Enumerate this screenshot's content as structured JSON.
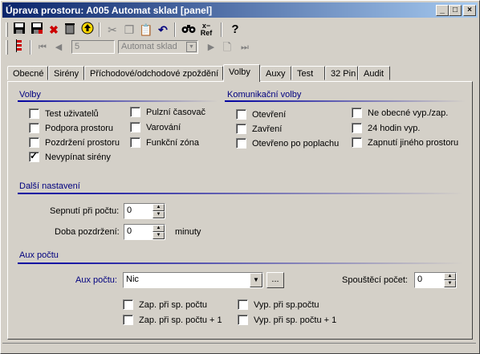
{
  "window": {
    "title": "Úprava prostoru: A005 Automat sklad [panel]"
  },
  "caption_buttons": {
    "minimize": "_",
    "maximize": "□",
    "close": "×"
  },
  "toolbar": {
    "ref_label": "Ref",
    "ref_prefix": "x−",
    "record_number": "5",
    "record_name": "Automat sklad"
  },
  "tabs": [
    {
      "label": "Obecné"
    },
    {
      "label": "Sirény"
    },
    {
      "label": "Příchodové/odchodové zpoždění"
    },
    {
      "label": "Volby"
    },
    {
      "label": "Auxy"
    },
    {
      "label": "Test"
    },
    {
      "label": "32 Pin"
    },
    {
      "label": "Audit"
    }
  ],
  "volby": {
    "title": "Volby",
    "col1": [
      {
        "label": "Test uživatelů",
        "checked": false
      },
      {
        "label": "Podpora prostoru",
        "checked": false
      },
      {
        "label": "Pozdržení prostoru",
        "checked": false
      },
      {
        "label": "Nevypínat sirény",
        "checked": true
      }
    ],
    "col2": [
      {
        "label": "Pulzní časovač",
        "checked": false
      },
      {
        "label": "Varování",
        "checked": false
      },
      {
        "label": "Funkční zóna",
        "checked": false
      }
    ]
  },
  "komunikacni": {
    "title": "Komunikační volby",
    "col1": [
      {
        "label": "Otevření",
        "checked": false
      },
      {
        "label": "Zavření",
        "checked": false
      },
      {
        "label": "Otevřeno po poplachu",
        "checked": false
      }
    ],
    "col2": [
      {
        "label": "Ne obecné vyp./zap.",
        "checked": false
      },
      {
        "label": "24 hodin vyp.",
        "checked": false
      },
      {
        "label": "Zapnutí jiného prostoru",
        "checked": false
      }
    ]
  },
  "dalsi": {
    "title": "Další nastavení",
    "sepnuti_label": "Sepnutí při počtu:",
    "sepnuti_value": "0",
    "doba_label": "Doba pozdržení:",
    "doba_value": "0",
    "doba_unit": "minuty"
  },
  "aux": {
    "title": "Aux počtu",
    "aux_label": "Aux počtu:",
    "aux_value": "Nic",
    "browse_label": "...",
    "spousteci_label": "Spouštěcí počet:",
    "spousteci_value": "0",
    "checks": [
      {
        "label": "Zap. při sp. počtu",
        "checked": false
      },
      {
        "label": "Zap. při sp. počtu + 1",
        "checked": false
      },
      {
        "label": "Vyp. při sp.počtu",
        "checked": false
      },
      {
        "label": "Vyp. při sp. počtu + 1",
        "checked": false
      }
    ]
  }
}
